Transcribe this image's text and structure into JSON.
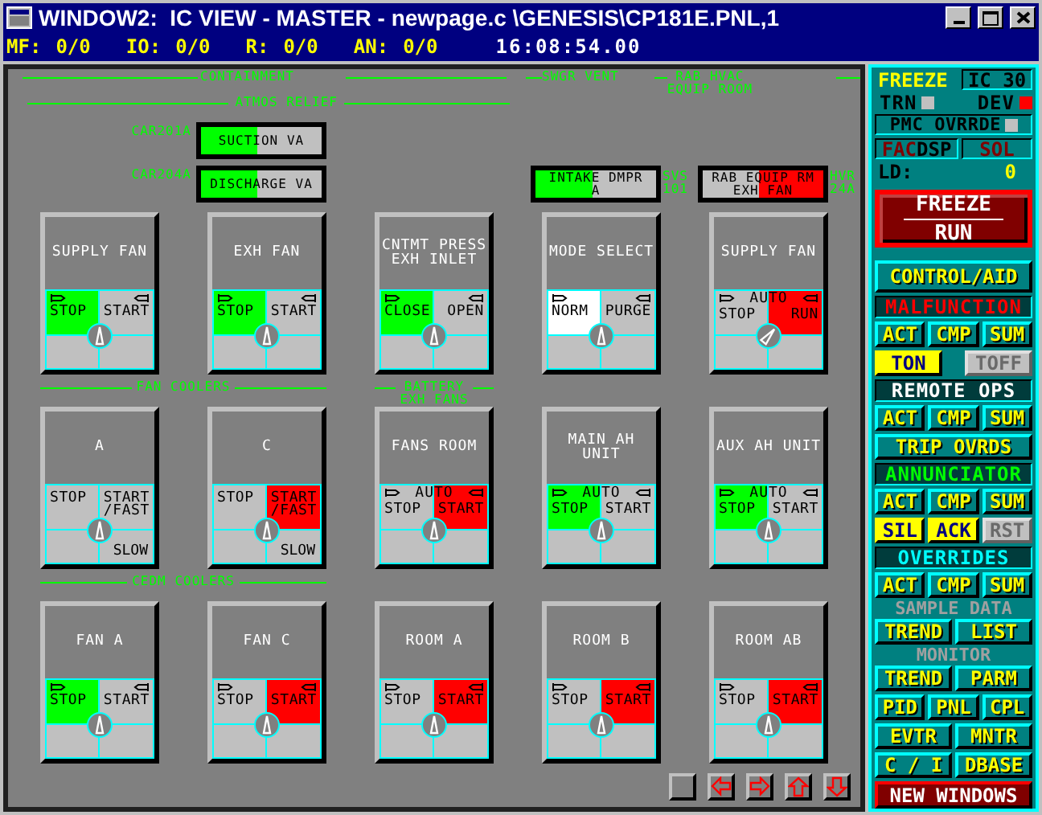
{
  "window": {
    "title": "WINDOW2:  IC VIEW - MASTER - newpage.c \\GENESIS\\CP181E.PNL,1"
  },
  "status_bar": {
    "counters": [
      {
        "label": "MF:",
        "value": "0/0"
      },
      {
        "label": "IO:",
        "value": "0/0"
      },
      {
        "label": "R:",
        "value": "0/0"
      },
      {
        "label": "AN:",
        "value": "0/0"
      }
    ],
    "time": "16:08:54.00"
  },
  "panel": {
    "section_labels": [
      "CONTAINMENT",
      "SWGR VENT",
      "RAB HVAC\nEQUIP ROOM"
    ],
    "subsection_label": "ATMOS RELIEF",
    "relief_valves": [
      {
        "tag": "CAR201A",
        "label": "SUCTION VA",
        "left_lit": true,
        "right_lit": false,
        "color": "#00ff00"
      },
      {
        "tag": "CAR204A",
        "label": "DISCHARGE VA",
        "left_lit": true,
        "right_lit": false,
        "color": "#00ff00"
      }
    ],
    "hvac_dampers": [
      {
        "label": "INTAKE DMPR\nA",
        "left_lit": true,
        "right_lit": false,
        "color": "#00ff00",
        "tag": "SVS\n101"
      },
      {
        "label": "RAB EQUIP RM\nEXH FAN",
        "left_lit": false,
        "right_lit": true,
        "color": "#ff0000",
        "tag": "HVR\n24A"
      }
    ],
    "tile_rows": [
      {
        "groups": [
          {
            "tiles": [
              {
                "title": "SUPPLY FAN",
                "flags": true,
                "knob_turned": false,
                "left": {
                  "label": "STOP",
                  "lit": true,
                  "color": "#00ff00"
                },
                "right": {
                  "label": "START",
                  "lit": false
                }
              },
              {
                "title": "EXH FAN",
                "flags": true,
                "knob_turned": false,
                "left": {
                  "label": "STOP",
                  "lit": true,
                  "color": "#00ff00"
                },
                "right": {
                  "label": "START",
                  "lit": false
                }
              },
              {
                "title": "CNTMT PRESS\nEXH INLET",
                "flags": true,
                "knob_turned": false,
                "left": {
                  "label": "CLOSE",
                  "lit": true,
                  "color": "#00ff00"
                },
                "right": {
                  "label": "OPEN",
                  "lit": false
                }
              },
              {
                "title": "MODE SELECT",
                "flags": true,
                "knob_turned": false,
                "left": {
                  "label": "NORM",
                  "lit": true,
                  "color": "#ffffff"
                },
                "right": {
                  "label": "PURGE",
                  "lit": false
                }
              },
              {
                "title": "SUPPLY FAN",
                "flags": true,
                "knob_turned": true,
                "auto": "AUTO",
                "left": {
                  "label": "STOP",
                  "lit": false
                },
                "right": {
                  "label": "RUN",
                  "lit": true,
                  "color": "#ff0000"
                }
              }
            ]
          }
        ]
      },
      {
        "groups": [
          {
            "label": "FAN COOLERS",
            "tiles": [
              {
                "title": "A",
                "flags": false,
                "knob_turned": false,
                "bottom": "SLOW",
                "left": {
                  "label": "STOP",
                  "lit": false
                },
                "right": {
                  "label": "START\n/FAST",
                  "lit": false
                }
              },
              {
                "title": "C",
                "flags": false,
                "knob_turned": false,
                "bottom": "SLOW",
                "left": {
                  "label": "STOP",
                  "lit": false
                },
                "right": {
                  "label": "START\n/FAST",
                  "lit": true,
                  "color": "#ff0000"
                }
              }
            ]
          },
          {
            "label": "BATTERY\nEXH FANS",
            "tiles": [
              {
                "title": "FANS ROOM",
                "flags": true,
                "knob_turned": false,
                "auto": "AUTO",
                "left": {
                  "label": "STOP",
                  "lit": false
                },
                "right": {
                  "label": "START",
                  "lit": true,
                  "color": "#ff0000"
                }
              }
            ]
          },
          {
            "tiles": [
              {
                "title": "MAIN AH\nUNIT",
                "flags": true,
                "knob_turned": false,
                "auto": "AUTO",
                "left": {
                  "label": "STOP",
                  "lit": true,
                  "color": "#00ff00"
                },
                "right": {
                  "label": "START",
                  "lit": false
                }
              },
              {
                "title": "AUX AH UNIT",
                "flags": true,
                "knob_turned": false,
                "auto": "AUTO",
                "left": {
                  "label": "STOP",
                  "lit": true,
                  "color": "#00ff00"
                },
                "right": {
                  "label": "START",
                  "lit": false
                }
              }
            ]
          }
        ]
      },
      {
        "groups": [
          {
            "label": "CEDM COOLERS",
            "tiles": [
              {
                "title": "FAN A",
                "flags": true,
                "knob_turned": false,
                "left": {
                  "label": "STOP",
                  "lit": true,
                  "color": "#00ff00"
                },
                "right": {
                  "label": "START",
                  "lit": false
                }
              },
              {
                "title": "FAN C",
                "flags": true,
                "knob_turned": false,
                "left": {
                  "label": "STOP",
                  "lit": false
                },
                "right": {
                  "label": "START",
                  "lit": true,
                  "color": "#ff0000"
                }
              }
            ]
          },
          {
            "tiles": [
              {
                "title": "ROOM A",
                "flags": true,
                "knob_turned": false,
                "left": {
                  "label": "STOP",
                  "lit": false
                },
                "right": {
                  "label": "START",
                  "lit": true,
                  "color": "#ff0000"
                }
              },
              {
                "title": "ROOM B",
                "flags": true,
                "knob_turned": false,
                "left": {
                  "label": "STOP",
                  "lit": false
                },
                "right": {
                  "label": "START",
                  "lit": true,
                  "color": "#ff0000"
                }
              },
              {
                "title": "ROOM AB",
                "flags": true,
                "knob_turned": false,
                "left": {
                  "label": "STOP",
                  "lit": false
                },
                "right": {
                  "label": "START",
                  "lit": true,
                  "color": "#ff0000"
                }
              }
            ]
          }
        ]
      }
    ]
  },
  "sidebar": {
    "rows": [
      {
        "items": [
          {
            "kind": "label",
            "text": "FREEZE",
            "color": "#ffff00"
          },
          {
            "kind": "box",
            "text": "IC 30",
            "color": "#000000"
          }
        ]
      },
      {
        "items": [
          {
            "kind": "lamp",
            "text": "TRN",
            "color": "#c0c0c0"
          },
          {
            "kind": "lamp",
            "text": "DEV",
            "color": "#ff0000"
          }
        ]
      },
      {
        "items": [
          {
            "kind": "lamp_box",
            "text": "PMC OVRRDE",
            "color": "#c0c0c0"
          }
        ]
      },
      {
        "items": [
          {
            "kind": "box",
            "parts": [
              {
                "text": "FAC",
                "color": "#800000"
              },
              {
                "text": "DSP",
                "color": "#000000"
              }
            ]
          },
          {
            "kind": "box",
            "text": "SOL",
            "color": "#800000"
          }
        ]
      },
      {
        "items": [
          {
            "kind": "label",
            "text": "LD:",
            "color": "#000000"
          },
          {
            "kind": "label",
            "text": "0",
            "color": "#ffff00"
          }
        ]
      },
      {
        "items": [
          {
            "kind": "big",
            "text": "FREEZE",
            "text2": "RUN"
          }
        ]
      },
      {
        "items": [
          {
            "kind": "button",
            "text": "CONTROL/AID",
            "on": false,
            "disabled": false
          }
        ]
      },
      {
        "items": [
          {
            "kind": "header",
            "text": "MALFUNCTION",
            "color": "#ff0000"
          }
        ]
      },
      {
        "items": [
          {
            "kind": "button",
            "text": "ACT",
            "on": false,
            "disabled": false
          },
          {
            "kind": "button",
            "text": "CMP",
            "on": false,
            "disabled": false
          },
          {
            "kind": "button",
            "text": "SUM",
            "on": false,
            "disabled": false
          }
        ]
      },
      {
        "items": [
          {
            "kind": "button",
            "text": "TON",
            "on": true,
            "disabled": false
          },
          {
            "kind": "button",
            "text": "TOFF",
            "on": false,
            "disabled": true
          }
        ]
      },
      {
        "items": [
          {
            "kind": "header",
            "text": "REMOTE OPS",
            "color": "#ffffff"
          }
        ]
      },
      {
        "items": [
          {
            "kind": "button",
            "text": "ACT",
            "on": false,
            "disabled": false
          },
          {
            "kind": "button",
            "text": "CMP",
            "on": false,
            "disabled": false
          },
          {
            "kind": "button",
            "text": "SUM",
            "on": false,
            "disabled": false
          }
        ]
      },
      {
        "items": [
          {
            "kind": "button",
            "text": "TRIP OVRDS",
            "on": false,
            "disabled": false
          }
        ]
      },
      {
        "items": [
          {
            "kind": "header",
            "text": "ANNUNCIATOR",
            "color": "#00ff00"
          }
        ]
      },
      {
        "items": [
          {
            "kind": "button",
            "text": "ACT",
            "on": false,
            "disabled": false
          },
          {
            "kind": "button",
            "text": "CMP",
            "on": false,
            "disabled": false
          },
          {
            "kind": "button",
            "text": "SUM",
            "on": false,
            "disabled": false
          }
        ]
      },
      {
        "items": [
          {
            "kind": "button",
            "text": "SIL",
            "on": true,
            "disabled": false
          },
          {
            "kind": "button",
            "text": "ACK",
            "on": true,
            "disabled": false
          },
          {
            "kind": "button",
            "text": "RST",
            "on": false,
            "disabled": true
          }
        ]
      },
      {
        "items": [
          {
            "kind": "header",
            "text": "OVERRIDES",
            "color": "#00ffff"
          }
        ]
      },
      {
        "items": [
          {
            "kind": "button",
            "text": "ACT",
            "on": false,
            "disabled": false
          },
          {
            "kind": "button",
            "text": "CMP",
            "on": false,
            "disabled": false
          },
          {
            "kind": "button",
            "text": "SUM",
            "on": false,
            "disabled": false
          }
        ]
      },
      {
        "items": [
          {
            "kind": "caption",
            "text": "SAMPLE DATA",
            "color": "#a0a0a0"
          }
        ]
      },
      {
        "items": [
          {
            "kind": "button",
            "text": "TREND",
            "on": false,
            "disabled": false
          },
          {
            "kind": "button",
            "text": "LIST",
            "on": false,
            "disabled": false
          }
        ]
      },
      {
        "items": [
          {
            "kind": "caption",
            "text": "MONITOR",
            "color": "#a0a0a0"
          }
        ]
      },
      {
        "items": [
          {
            "kind": "button",
            "text": "TREND",
            "on": false,
            "disabled": false
          },
          {
            "kind": "button",
            "text": "PARM",
            "on": false,
            "disabled": false
          }
        ]
      },
      {
        "items": [
          {
            "kind": "button",
            "text": "PID",
            "on": false,
            "disabled": false
          },
          {
            "kind": "button",
            "text": "PNL",
            "on": false,
            "disabled": false
          },
          {
            "kind": "button",
            "text": "CPL",
            "on": false,
            "disabled": false
          }
        ]
      },
      {
        "items": [
          {
            "kind": "button",
            "text": "EVTR",
            "on": false,
            "disabled": false
          },
          {
            "kind": "button",
            "text": "MNTR",
            "on": false,
            "disabled": false
          }
        ]
      },
      {
        "items": [
          {
            "kind": "button",
            "text": "C / I",
            "on": false,
            "disabled": false
          },
          {
            "kind": "button",
            "text": "DBASE",
            "on": false,
            "disabled": false
          }
        ]
      },
      {
        "items": [
          {
            "kind": "alert",
            "text": "NEW WINDOWS"
          }
        ]
      }
    ]
  }
}
